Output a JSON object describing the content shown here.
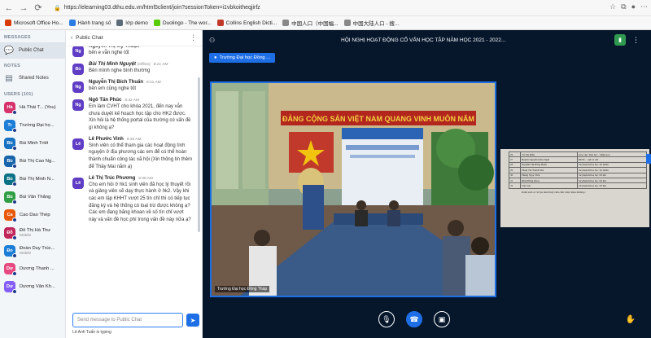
{
  "browser": {
    "url": "https://elearning03.dthu.edu.vn/html5client/join?sessionToken=i1vbkoitheqjirfz",
    "bookmarks": [
      {
        "label": "Microsoft Office Ho...",
        "color": "#d83b01"
      },
      {
        "label": "Hành trang số",
        "color": "#2a7de1"
      },
      {
        "label": "lớp demo",
        "color": "#5b6b7a"
      },
      {
        "label": "Duolingo - The wor...",
        "color": "#58cc02"
      },
      {
        "label": "Collins English Dicti...",
        "color": "#c0392b"
      },
      {
        "label": "中国人口（中国幅...",
        "color": "#888888"
      },
      {
        "label": "中国大陆人口 - 搜...",
        "color": "#888888"
      }
    ]
  },
  "sidebar": {
    "messages_heading": "MESSAGES",
    "public_chat": "Public Chat",
    "notes_heading": "NOTES",
    "shared_notes": "Shared Notes",
    "users_heading": "USERS (101)",
    "users": [
      {
        "initials": "Hà",
        "name": "Hà Thái T... (You)",
        "sub": "",
        "color": "#d6336c"
      },
      {
        "initials": "Tr",
        "name": "Trường Đại họ...",
        "sub": "",
        "color": "#1c7ed6"
      },
      {
        "initials": "Bù",
        "name": "Bùi Minh Triết",
        "sub": "",
        "color": "#1971c2"
      },
      {
        "initials": "Bù",
        "name": "Bùi Thị Cao Ng...",
        "sub": "",
        "color": "#1864ab"
      },
      {
        "initials": "Bù",
        "name": "Bùi Thị Minh N...",
        "sub": "",
        "color": "#0b7285"
      },
      {
        "initials": "Bù",
        "name": "Bùi Văn Thắng",
        "sub": "",
        "color": "#2f9e44"
      },
      {
        "initials": "Ca",
        "name": "Cao Dao Thép",
        "sub": "",
        "color": "#e8590c"
      },
      {
        "initials": "Đỗ",
        "name": "Đỗ Thị Hà Thư",
        "sub": "Mobile",
        "color": "#c2255c"
      },
      {
        "initials": "Đo",
        "name": "Đoàn Duy Trúc...",
        "sub": "Mobile",
        "color": "#1c7ed6"
      },
      {
        "initials": "Dư",
        "name": "Dương Thanh ...",
        "sub": "",
        "color": "#e64980"
      },
      {
        "initials": "Dư",
        "name": "Dương Văn Kh...",
        "sub": "",
        "color": "#845ef7"
      }
    ]
  },
  "chat": {
    "title": "Public Chat",
    "messages": [
      {
        "initials": "Ng",
        "name": "Nguyễn Thị Mỹ Thuận",
        "time": "",
        "status": "",
        "text": "bên e vẫn nghe tốt",
        "color": "#5f3dc4"
      },
      {
        "initials": "Bù",
        "name": "Bùi Thị Minh Nguyệt",
        "time": "8:21 AM",
        "status": "(offline)",
        "text": "Bên mình nghe bình thường",
        "color": "#5f3dc4"
      },
      {
        "initials": "Ng",
        "name": "Nguyễn Thị Bích Thuấn",
        "time": "8:21 AM",
        "status": "",
        "text": "bên em cũng nghe tốt",
        "color": "#5f3dc4"
      },
      {
        "initials": "Ng",
        "name": "Ngô Tấn Phúc",
        "time": "8:32 AM",
        "status": "",
        "text": "Em làm CVHT cho khóa 2021, đến nay vẫn chưa duyệt kế hoạch học tập cho HK2 được. Xin hỏi là hệ thống portal của trường có vấn đề gì không ạ?",
        "color": "#5f3dc4"
      },
      {
        "initials": "Lê",
        "name": "Lê Phước Vinh",
        "time": "8:33 AM",
        "status": "",
        "text": "Sinh viên có thể tham gia các hoạt động tình nguyện ở địa phương các em để có thể hoàn thành chuẩn công tác xã hội (Xin thông tin thêm để Thầy Mai nắm ạ)",
        "color": "#5f3dc4"
      },
      {
        "initials": "Lê",
        "name": "Lê Thị Trúc Phương",
        "time": "8:38 AM",
        "status": "",
        "text": "Cho em hỏi ở hk1 sinh viên đã học lý thuyết rồi và giảng viên sẽ dạy thực hành ở hk2. Vậy khi các em lập KHHT vượt 25 tín chỉ thì có tiếp tục đăng ký và hệ thống có loại trừ được không ạ? Các em đang băng khoan về số tín chỉ vượt này và vấn đề học phí trong vấn đề này nữa ạ?",
        "color": "#5f3dc4"
      }
    ],
    "input_placeholder": "Send message to Public Chat",
    "typing": "Lê Anh Tuấn is typing"
  },
  "presentation": {
    "title": "HỘI NGHỊ HOẠT ĐỘNG CỐ VẤN HỌC TẬP NĂM HỌC 2021 - 2022...",
    "presenter": "Trường Đại học Đồng ...",
    "video_label": "Trường Đại học Đồng Tháp",
    "banner_text": "ĐẢNG CỘNG SẢN VIỆT NAM QUANG VINH MUÔN NĂM",
    "doc_rows": [
      [
        "26",
        "Võ Thị Hiền",
        "Giáo dục Tiểu học - Mầm non"
      ],
      [
        "27",
        "Huỳnh Nguyễn Kiều Ngân",
        "ĐDTC - QP và AN"
      ],
      [
        "28",
        "Nguyễn Thị Hồng Hạnh",
        "Sư phạm Khoa học Tự nhiên"
      ],
      [
        "29",
        "Phạm Thị Thanh Mai",
        "Sư phạm Khoa học Tự nhiên"
      ],
      [
        "30",
        "Phùng Ngọc Tiến",
        "Sư phạm Khoa học Xã hội"
      ],
      [
        "31",
        "Đinh Hồng Khoa",
        "Sư phạm Khoa học Xã hội"
      ],
      [
        "32",
        "Tôn Sơn",
        "Sư phạm Khoa học Xã hội"
      ]
    ],
    "doc_footer": "Danh sách có 32 (ba mươi hai) viên chức được khen thưởng./."
  }
}
